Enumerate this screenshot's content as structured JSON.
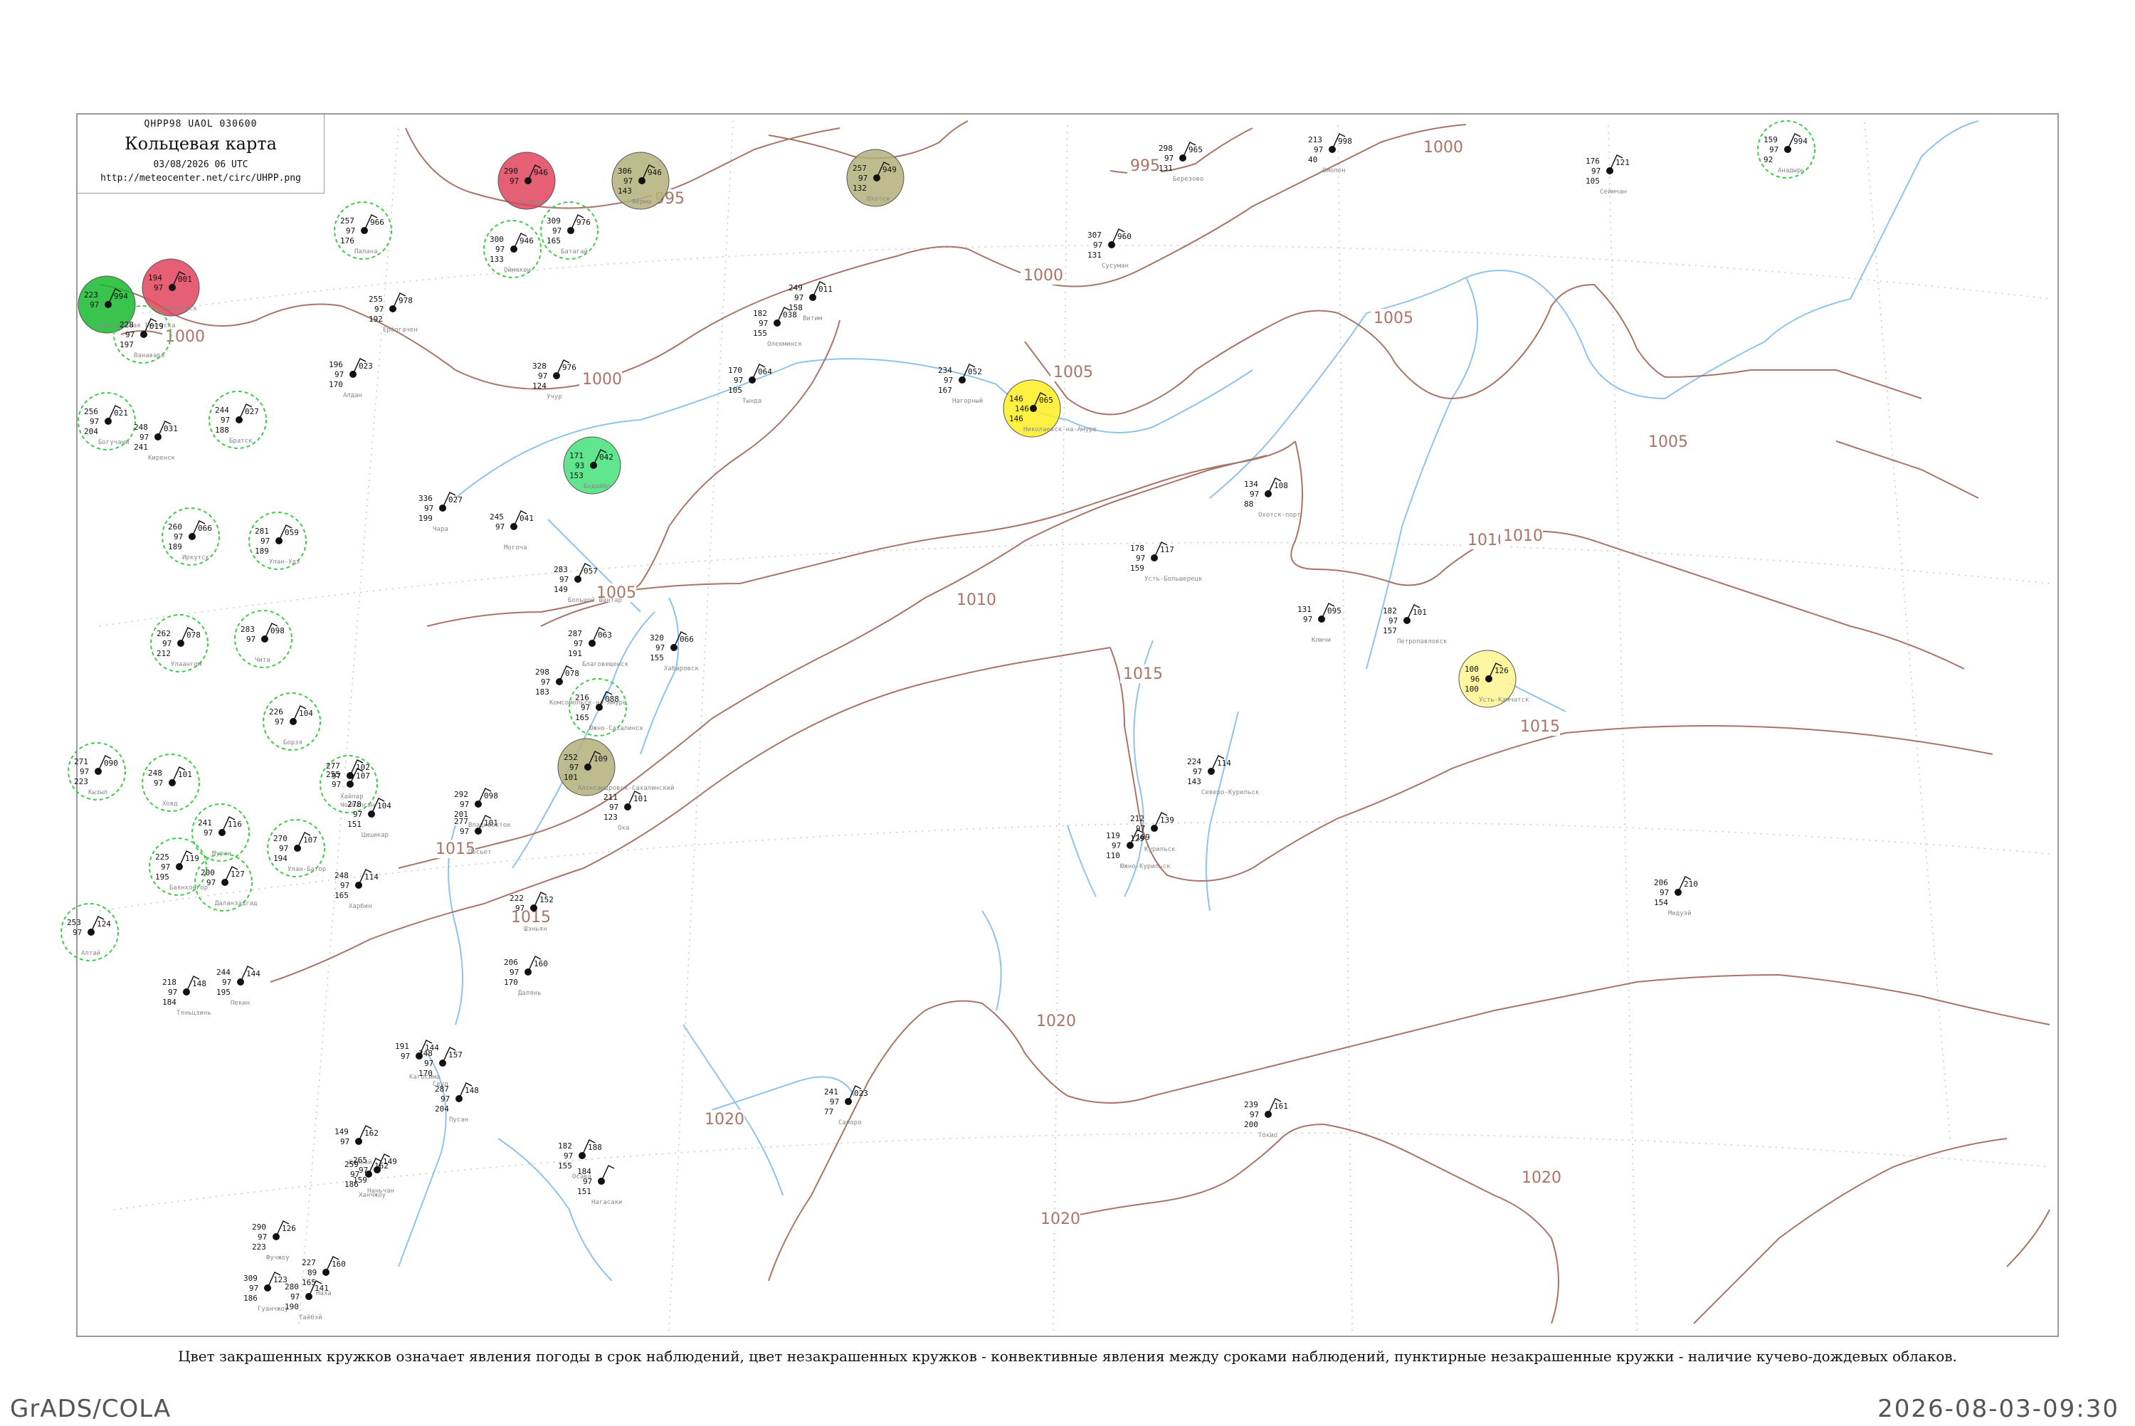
{
  "header": {
    "code": "QHPP98  UAOL  030600",
    "title": "Кольцевая карта",
    "datetime": "03/08/2026 06 UTC",
    "url": "http://meteocenter.net/circ/UHPP.png"
  },
  "caption": "Цвет закрашенных кружков означает явления погоды в срок наблюдений, цвет незакрашенных кружков - конвективные явления между сроками наблюдений, пунктирные незакрашенные кружки - наличие кучево-дождевых облаков.",
  "footer": {
    "left": "GrADS/COLA",
    "right": "2026-08-03-09:30"
  },
  "colors": {
    "isobar": "#a87468",
    "river": "#8fc3ea",
    "frame": "#9a9a9a",
    "thunder": "#e0445c",
    "rain_green": "#18b92e",
    "shower_light_green": "#45e07a",
    "fog_yellow": "#ffee22",
    "haze_light_yellow": "#fff590",
    "dust_olive": "#b3b07a",
    "cb_dashed_green": "#3fc94a"
  },
  "isobar_labels": [
    {
      "text": "995"
    },
    {
      "text": "995"
    },
    {
      "text": "1000"
    },
    {
      "text": "1000"
    },
    {
      "text": "1000"
    },
    {
      "text": "1000"
    },
    {
      "text": "1005"
    },
    {
      "text": "1005"
    },
    {
      "text": "1005"
    },
    {
      "text": "1005"
    },
    {
      "text": "1010"
    },
    {
      "text": "1010"
    },
    {
      "text": "1010"
    },
    {
      "text": "1015"
    },
    {
      "text": "1015"
    },
    {
      "text": "1015"
    },
    {
      "text": "1015"
    },
    {
      "text": "1020"
    },
    {
      "text": "1020"
    },
    {
      "text": "1020"
    },
    {
      "text": "1020"
    }
  ],
  "stations": [
    {
      "name": "Палана",
      "t": "257",
      "n": "97",
      "p": "966",
      "b": "176",
      "ring": "dashed"
    },
    {
      "name": "Хатанга",
      "t": "290",
      "n": "97",
      "p": "946",
      "b": "",
      "ring": "red"
    },
    {
      "name": "Ферма",
      "t": "306",
      "n": "97",
      "p": "946",
      "b": "143",
      "ring": "olive"
    },
    {
      "name": "Охотск",
      "t": "257",
      "n": "97",
      "p": "949",
      "b": "132",
      "ring": "olive"
    },
    {
      "name": "Оймякон",
      "t": "300",
      "n": "97",
      "p": "946",
      "b": "133",
      "ring": "dashed"
    },
    {
      "name": "Батагай",
      "t": "309",
      "n": "97",
      "p": "976",
      "b": "165",
      "ring": "dashed"
    },
    {
      "name": "Сусуман",
      "t": "307",
      "n": "97",
      "p": "960",
      "b": "131",
      "ring": "none"
    },
    {
      "name": "Березово",
      "t": "298",
      "n": "97",
      "p": "965",
      "b": "131",
      "ring": "none"
    },
    {
      "name": "Омолон",
      "t": "213",
      "n": "97",
      "p": "998",
      "b": "40",
      "ring": "none"
    },
    {
      "name": "Сеймчан",
      "t": "176",
      "n": "97",
      "p": "121",
      "b": "105",
      "ring": "none"
    },
    {
      "name": "Анадырь",
      "t": "159",
      "n": "97",
      "p": "994",
      "b": "92",
      "ring": "dashed"
    },
    {
      "name": "Туруханск",
      "t": "194",
      "n": "97",
      "p": "001",
      "b": "",
      "ring": "red"
    },
    {
      "name": "Подкаменная Тунгуска",
      "t": "223",
      "n": "97",
      "p": "994",
      "b": "",
      "ring": "green"
    },
    {
      "name": "Ванавара",
      "t": "228",
      "n": "97",
      "p": "019",
      "b": "197",
      "ring": "dashed"
    },
    {
      "name": "Ербогачен",
      "t": "255",
      "n": "97",
      "p": "978",
      "b": "192",
      "ring": "none"
    },
    {
      "name": "Витим",
      "t": "249",
      "n": "97",
      "p": "011",
      "b": "158",
      "ring": "none"
    },
    {
      "name": "Олекминск",
      "t": "182",
      "n": "97",
      "p": "038",
      "b": "155",
      "ring": "none"
    },
    {
      "name": "Алдан",
      "t": "196",
      "n": "97",
      "p": "023",
      "b": "170",
      "ring": "none"
    },
    {
      "name": "Учур",
      "t": "328",
      "n": "97",
      "p": "976",
      "b": "124",
      "ring": "none"
    },
    {
      "name": "Тында",
      "t": "170",
      "n": "97",
      "p": "064",
      "b": "105",
      "ring": "none"
    },
    {
      "name": "Нагорный",
      "t": "234",
      "n": "97",
      "p": "052",
      "b": "167",
      "ring": "none"
    },
    {
      "name": "Николаевск-на-Амуре",
      "t": "146",
      "n": "146",
      "p": "065",
      "b": "146",
      "ring": "yellow"
    },
    {
      "name": "Богучаны",
      "t": "256",
      "n": "97",
      "p": "021",
      "b": "204",
      "ring": "dashed"
    },
    {
      "name": "Братск",
      "t": "244",
      "n": "97",
      "p": "027",
      "b": "188",
      "ring": "dashed"
    },
    {
      "name": "Киренск",
      "t": "248",
      "n": "97",
      "p": "031",
      "b": "241",
      "ring": "none"
    },
    {
      "name": "Бодайбо",
      "t": "171",
      "n": "93",
      "p": "042",
      "b": "153",
      "ring": "lightgreen"
    },
    {
      "name": "Чара",
      "t": "336",
      "n": "97",
      "p": "027",
      "b": "199",
      "ring": "none"
    },
    {
      "name": "Могоча",
      "t": "245",
      "n": "97",
      "p": "041",
      "b": "",
      "ring": "none"
    },
    {
      "name": "Большой Шантар",
      "t": "283",
      "n": "97",
      "p": "057",
      "b": "149",
      "ring": "none"
    },
    {
      "name": "Охотск-порт",
      "t": "134",
      "n": "97",
      "p": "108",
      "b": "88",
      "ring": "none"
    },
    {
      "name": "Усть-Камчатск",
      "t": "100",
      "n": "96",
      "p": "126",
      "b": "100",
      "ring": "lightyellow"
    },
    {
      "name": "Петропавловск",
      "t": "182",
      "n": "97",
      "p": "101",
      "b": "157",
      "ring": "none"
    },
    {
      "name": "Ключи",
      "t": "131",
      "n": "97",
      "p": "095",
      "b": "",
      "ring": "none"
    },
    {
      "name": "Усть-Большерецк",
      "t": "178",
      "n": "97",
      "p": "117",
      "b": "159",
      "ring": "none"
    },
    {
      "name": "Иркутск",
      "t": "260",
      "n": "97",
      "p": "066",
      "b": "189",
      "ring": "dashed"
    },
    {
      "name": "Улан-Удэ",
      "t": "281",
      "n": "97",
      "p": "059",
      "b": "189",
      "ring": "dashed"
    },
    {
      "name": "Чита",
      "t": "283",
      "n": "97",
      "p": "098",
      "b": "",
      "ring": "dashed"
    },
    {
      "name": "Борзя",
      "t": "226",
      "n": "97",
      "p": "104",
      "b": "",
      "ring": "dashed"
    },
    {
      "name": "Благовещенск",
      "t": "287",
      "n": "97",
      "p": "063",
      "b": "191",
      "ring": "none"
    },
    {
      "name": "Хабаровск",
      "t": "320",
      "n": "97",
      "p": "066",
      "b": "155",
      "ring": "none"
    },
    {
      "name": "Комсомольск-на-Амуре",
      "t": "298",
      "n": "97",
      "p": "078",
      "b": "183",
      "ring": "none"
    },
    {
      "name": "Южно-Сахалинск",
      "t": "216",
      "n": "97",
      "p": "088",
      "b": "165",
      "ring": "dashed"
    },
    {
      "name": "Александровск-Сахалинский",
      "t": "252",
      "n": "97",
      "p": "109",
      "b": "101",
      "ring": "olive"
    },
    {
      "name": "Оха",
      "t": "211",
      "n": "97",
      "p": "101",
      "b": "123",
      "ring": "none"
    },
    {
      "name": "Северо-Курильск",
      "t": "224",
      "n": "97",
      "p": "114",
      "b": "143",
      "ring": "none"
    },
    {
      "name": "Курильск",
      "t": "212",
      "n": "97",
      "p": "139",
      "b": "129",
      "ring": "none"
    },
    {
      "name": "Южно-Курильск",
      "t": "119",
      "n": "97",
      "p": "169",
      "b": "110",
      "ring": "none"
    },
    {
      "name": "Владивосток",
      "t": "292",
      "n": "97",
      "p": "098",
      "b": "201",
      "ring": "none"
    },
    {
      "name": "Посьет",
      "t": "277",
      "n": "97",
      "p": "101",
      "b": "",
      "ring": "none"
    },
    {
      "name": "Кызыл",
      "t": "271",
      "n": "97",
      "p": "090",
      "b": "223",
      "ring": "dashed"
    },
    {
      "name": "Ховд",
      "t": "248",
      "n": "97",
      "p": "101",
      "b": "",
      "ring": "dashed"
    },
    {
      "name": "Улаангом",
      "t": "262",
      "n": "97",
      "p": "078",
      "b": "212",
      "ring": "dashed"
    },
    {
      "name": "Мурэн",
      "t": "241",
      "n": "97",
      "p": "116",
      "b": "",
      "ring": "dashed"
    },
    {
      "name": "Улан-Батор",
      "t": "270",
      "n": "97",
      "p": "107",
      "b": "194",
      "ring": "dashed"
    },
    {
      "name": "Чойбалсан",
      "t": "255",
      "n": "97",
      "p": "107",
      "b": "",
      "ring": "dashed"
    },
    {
      "name": "Хайлар",
      "t": "277",
      "n": "97",
      "p": "102",
      "b": "",
      "ring": "none"
    },
    {
      "name": "Цицикар",
      "t": "278",
      "n": "97",
      "p": "104",
      "b": "151",
      "ring": "none"
    },
    {
      "name": "Харбин",
      "t": "248",
      "n": "97",
      "p": "114",
      "b": "165",
      "ring": "none"
    },
    {
      "name": "Шэньян",
      "t": "222",
      "n": "97",
      "p": "152",
      "b": "",
      "ring": "none"
    },
    {
      "name": "Далянь",
      "t": "206",
      "n": "97",
      "p": "160",
      "b": "170",
      "ring": "none"
    },
    {
      "name": "Пекин",
      "t": "244",
      "n": "97",
      "p": "144",
      "b": "195",
      "ring": "none"
    },
    {
      "name": "Тяньцзинь",
      "t": "218",
      "n": "97",
      "p": "148",
      "b": "184",
      "ring": "none"
    },
    {
      "name": "Алтай",
      "t": "253",
      "n": "97",
      "p": "124",
      "b": "",
      "ring": "dashed"
    },
    {
      "name": "Баянхонгор",
      "t": "225",
      "n": "97",
      "p": "119",
      "b": "195",
      "ring": "dashed"
    },
    {
      "name": "Даланзадгад",
      "t": "200",
      "n": "97",
      "p": "127",
      "b": "",
      "ring": "dashed"
    },
    {
      "name": "Сапоро",
      "t": "241",
      "n": "97",
      "p": "023",
      "b": "77",
      "ring": "none"
    },
    {
      "name": "Токио",
      "t": "239",
      "n": "97",
      "p": "161",
      "b": "200",
      "ring": "none"
    },
    {
      "name": "Кагосима",
      "t": "191",
      "n": "97",
      "p": "144",
      "b": "",
      "ring": "none"
    },
    {
      "name": "Сеул",
      "t": "248",
      "n": "97",
      "p": "157",
      "b": "170",
      "ring": "none"
    },
    {
      "name": "Пусан",
      "t": "287",
      "n": "97",
      "p": "148",
      "b": "204",
      "ring": "none"
    },
    {
      "name": "Осака",
      "t": "182",
      "n": "97",
      "p": "188",
      "b": "155",
      "ring": "none"
    },
    {
      "name": "Нагасаки",
      "t": "184",
      "n": "97",
      "p": "",
      "b": "151",
      "ring": "none"
    },
    {
      "name": "Шанхай",
      "t": "149",
      "n": "97",
      "p": "162",
      "b": "",
      "ring": "none"
    },
    {
      "name": "Ханчжоу",
      "t": "259",
      "n": "97",
      "p": "162",
      "b": "186",
      "ring": "none"
    },
    {
      "name": "Наньчан",
      "t": "265",
      "n": "97",
      "p": "149",
      "b": "159",
      "ring": "none"
    },
    {
      "name": "Фучжоу",
      "t": "290",
      "n": "97",
      "p": "126",
      "b": "223",
      "ring": "none"
    },
    {
      "name": "Гуанчжоу",
      "t": "309",
      "n": "97",
      "p": "123",
      "b": "186",
      "ring": "none"
    },
    {
      "name": "Тайбэй",
      "t": "280",
      "n": "97",
      "p": "141",
      "b": "190",
      "ring": "none"
    },
    {
      "name": "Наха",
      "t": "227",
      "n": "89",
      "p": "160",
      "b": "165",
      "ring": "none"
    },
    {
      "name": "Мидуэй",
      "t": "206",
      "n": "97",
      "p": "210",
      "b": "154",
      "ring": "none"
    }
  ]
}
